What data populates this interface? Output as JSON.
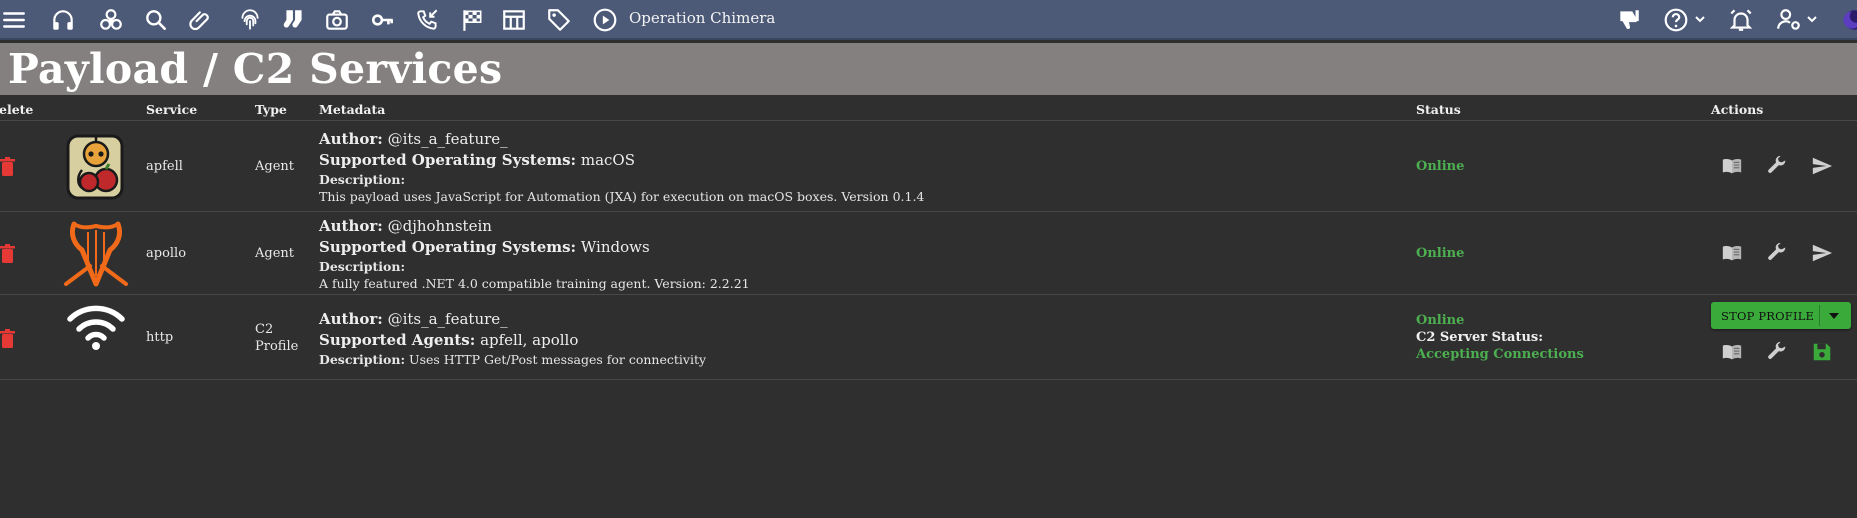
{
  "topbar": {
    "operation_name": "Operation Chimera",
    "icons": [
      "menu-icon",
      "headphones-icon",
      "biohazard-icon",
      "search-icon",
      "paperclip-icon",
      "fingerprint-icon",
      "socks-icon",
      "camera-icon",
      "key-icon",
      "phone-callback-icon",
      "checkered-flag-icon",
      "table-icon",
      "tag-icon",
      "play-circle-icon"
    ],
    "right_icons": [
      "thumbs-down-icon",
      "help-icon",
      "alarm-icon",
      "user-settings-icon",
      "moon-icon"
    ],
    "colors": {
      "bar": "#4c5a78"
    }
  },
  "page": {
    "title": "Payload / C2 Services"
  },
  "table": {
    "headers": {
      "delete": "elete",
      "service": "Service",
      "type": "Type",
      "metadata": "Metadata",
      "status": "Status",
      "actions": "Actions"
    },
    "rows": [
      {
        "service": "apfell",
        "type": "Agent",
        "author_label": "Author:",
        "author": " @its_a_feature_",
        "os_label": "Supported Operating Systems:",
        "os": " macOS",
        "desc_label": "Description:",
        "desc": "This payload uses JavaScript for Automation (JXA) for execution on macOS boxes. Version 0.1.4",
        "status": "Online",
        "logo": "apfell-logo"
      },
      {
        "service": "apollo",
        "type": "Agent",
        "author_label": "Author:",
        "author": " @djhohnstein",
        "os_label": "Supported Operating Systems:",
        "os": " Windows",
        "desc_label": "Description:",
        "desc": "A fully featured .NET 4.0 compatible training agent. Version: 2.2.21",
        "status": "Online",
        "logo": "apollo-logo"
      },
      {
        "service": "http",
        "type_line1": "C2",
        "type_line2": "Profile",
        "author_label": "Author:",
        "author": " @its_a_feature_",
        "agents_label": "Supported Agents:",
        "agents": " apfell, apollo",
        "desc_label": "Description:",
        "desc": " Uses HTTP Get/Post messages for connectivity",
        "status": "Online",
        "c2_status_label": "C2 Server Status:",
        "c2_status": "Accepting Connections",
        "stop_button": "STOP PROFILE",
        "logo": "wifi-icon"
      }
    ]
  },
  "colors": {
    "green": "#4caf50",
    "trash": "#e53935",
    "button_green": "#3aab3a"
  }
}
